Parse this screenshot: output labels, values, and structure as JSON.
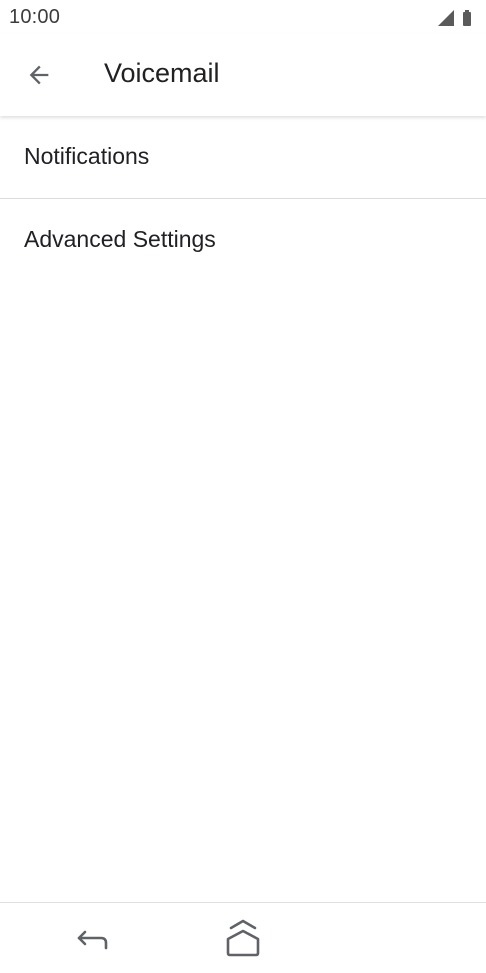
{
  "status_bar": {
    "time": "10:00",
    "icons": [
      "signal-icon",
      "battery-icon"
    ]
  },
  "app_bar": {
    "title": "Voicemail",
    "back_icon": "arrow-back-icon"
  },
  "settings_list": {
    "items": [
      {
        "label": "Notifications"
      },
      {
        "label": "Advanced Settings"
      }
    ]
  },
  "nav_bar": {
    "icons": [
      "nav-back-icon",
      "nav-home-icon"
    ]
  },
  "colors": {
    "text_primary": "#202124",
    "divider": "#dadce0",
    "icon": "#5f6368",
    "background": "#ffffff"
  }
}
